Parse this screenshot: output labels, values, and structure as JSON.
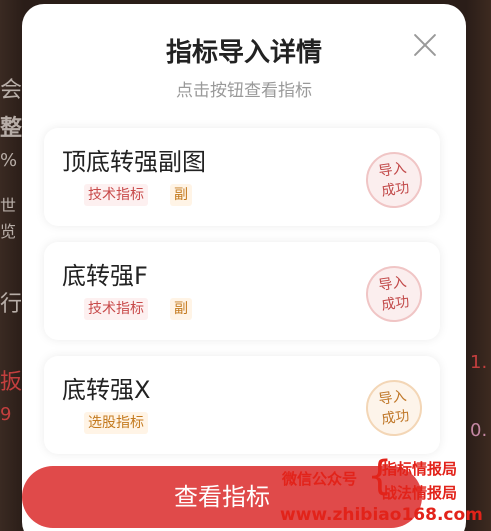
{
  "modal": {
    "title": "指标导入详情",
    "subtitle": "点击按钮查看指标",
    "close_icon": "close-icon"
  },
  "indicators": [
    {
      "name": "顶底转强副图",
      "type_tag": "技术指标",
      "sub_tag": "副",
      "status_line1": "导入",
      "status_line2": "成功"
    },
    {
      "name": "底转强F",
      "type_tag": "技术指标",
      "sub_tag": "副",
      "status_line1": "导入",
      "status_line2": "成功"
    },
    {
      "name": "底转强X",
      "type_tag": "选股指标",
      "sub_tag": "",
      "status_line1": "导入",
      "status_line2": "成功"
    }
  ],
  "footer": {
    "view_button_label": "查看指标"
  },
  "background_fragments": [
    "会",
    "整",
    "%",
    "世",
    "览",
    "行",
    "扳",
    "9",
    "1.",
    "0."
  ],
  "watermark": {
    "wechat": "微信公众号",
    "line_a": "指标情报局",
    "line_b": "战法情报局",
    "url": "www.zhibiao168.com"
  },
  "colors": {
    "accent": "#e04a4a",
    "stamp_red": "#c24a4a",
    "stamp_orange": "#c0782a",
    "watermark": "#e2231a"
  }
}
